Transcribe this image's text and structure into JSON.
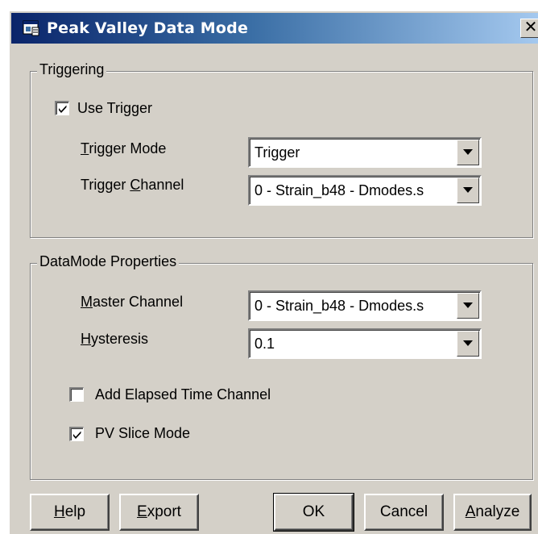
{
  "window": {
    "title": "Peak Valley Data Mode",
    "close_glyph": "✕"
  },
  "triggering": {
    "group_label": "Triggering",
    "use_trigger": {
      "label": "Use Trigger",
      "checked": true
    },
    "trigger_mode": {
      "label_access_key": "T",
      "label_rest": "rigger Mode",
      "value": "Trigger"
    },
    "trigger_channel": {
      "label_before": "Trigger ",
      "label_access_key": "C",
      "label_rest": "hannel",
      "value": "0 - Strain_b48 - Dmodes.s"
    }
  },
  "datamode": {
    "group_label": "DataMode Properties",
    "master_channel": {
      "label_access_key": "M",
      "label_rest": "aster Channel",
      "value": "0 - Strain_b48 - Dmodes.s"
    },
    "hysteresis": {
      "label_access_key": "H",
      "label_rest": "ysteresis",
      "value": "0.1"
    },
    "add_elapsed_time": {
      "label": "Add Elapsed Time Channel",
      "checked": false
    },
    "pv_slice_mode": {
      "label": "PV Slice Mode",
      "checked": true
    }
  },
  "buttons": {
    "help": {
      "access_key": "H",
      "rest": "elp"
    },
    "export": {
      "access_key": "E",
      "rest": "xport"
    },
    "ok": {
      "label": "OK"
    },
    "cancel": {
      "label": "Cancel"
    },
    "analyze": {
      "access_key": "A",
      "rest": "nalyze"
    }
  },
  "icons": {
    "title": "window-app-icon",
    "close": "close-icon",
    "check": "check-icon",
    "dropdown": "chevron-down-icon"
  }
}
